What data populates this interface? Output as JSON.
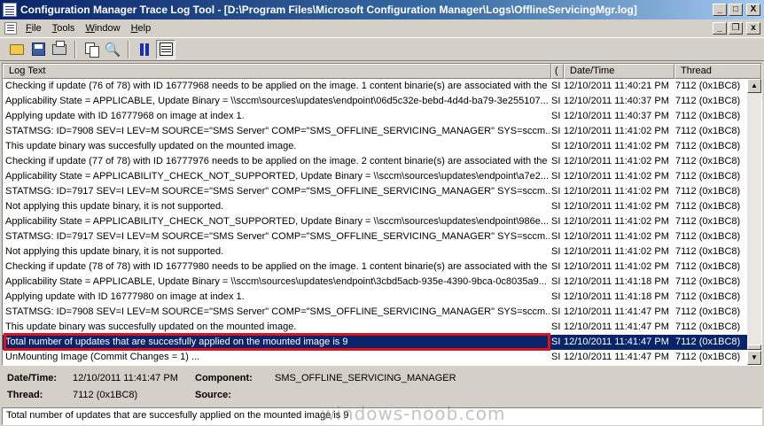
{
  "window": {
    "title": "Configuration Manager Trace Log Tool - [D:\\Program Files\\Microsoft Configuration Manager\\Logs\\OfflineServicingMgr.log]",
    "minimize_glyph": "_",
    "restore_glyph": "□",
    "close_glyph": "X"
  },
  "menu": {
    "items": [
      {
        "label": "File"
      },
      {
        "label": "Tools"
      },
      {
        "label": "Window"
      },
      {
        "label": "Help"
      }
    ],
    "mdi_minimize": "_",
    "mdi_restore": "❐",
    "mdi_close": "x"
  },
  "toolbar": {
    "icons": [
      "open-icon",
      "save-icon",
      "print-icon",
      "copy-icon",
      "find-icon",
      "pause-icon",
      "filter-list-icon"
    ]
  },
  "log": {
    "columns": [
      "Log Text",
      "(",
      "Date/Time",
      "Thread"
    ],
    "rows": [
      {
        "text": "Checking if update (76 of 78) with ID 16777968 needs to be applied on the image. 1 content binarie(s) are associated with the ...",
        "comp": "SI",
        "datetime": "12/10/2011 11:40:21 PM",
        "thread": "7112 (0x1BC8)"
      },
      {
        "text": "Applicability State = APPLICABLE, Update Binary = \\\\sccm\\sources\\updates\\endpoint\\06d5c32e-bebd-4d4d-ba79-3e255107...",
        "comp": "SI",
        "datetime": "12/10/2011 11:40:37 PM",
        "thread": "7112 (0x1BC8)"
      },
      {
        "text": "Applying update with ID 16777968 on image at index 1.",
        "comp": "SI",
        "datetime": "12/10/2011 11:40:37 PM",
        "thread": "7112 (0x1BC8)"
      },
      {
        "text": "STATMSG: ID=7908 SEV=I LEV=M SOURCE=\"SMS Server\" COMP=\"SMS_OFFLINE_SERVICING_MANAGER\" SYS=sccm....",
        "comp": "SI",
        "datetime": "12/10/2011 11:41:02 PM",
        "thread": "7112 (0x1BC8)"
      },
      {
        "text": "This update binary was succesfully updated on the mounted image.",
        "comp": "SI",
        "datetime": "12/10/2011 11:41:02 PM",
        "thread": "7112 (0x1BC8)"
      },
      {
        "text": "Checking if update (77 of 78) with ID 16777976 needs to be applied on the image. 2 content binarie(s) are associated with the ...",
        "comp": "SI",
        "datetime": "12/10/2011 11:41:02 PM",
        "thread": "7112 (0x1BC8)"
      },
      {
        "text": "Applicability State = APPLICABILITY_CHECK_NOT_SUPPORTED, Update Binary = \\\\sccm\\sources\\updates\\endpoint\\a7e2...",
        "comp": "SI",
        "datetime": "12/10/2011 11:41:02 PM",
        "thread": "7112 (0x1BC8)"
      },
      {
        "text": "STATMSG: ID=7917 SEV=I LEV=M SOURCE=\"SMS Server\" COMP=\"SMS_OFFLINE_SERVICING_MANAGER\" SYS=sccm....",
        "comp": "SI",
        "datetime": "12/10/2011 11:41:02 PM",
        "thread": "7112 (0x1BC8)"
      },
      {
        "text": "Not applying this update binary, it is not supported.",
        "comp": "SI",
        "datetime": "12/10/2011 11:41:02 PM",
        "thread": "7112 (0x1BC8)"
      },
      {
        "text": "Applicability State = APPLICABILITY_CHECK_NOT_SUPPORTED, Update Binary = \\\\sccm\\sources\\updates\\endpoint\\986e...",
        "comp": "SI",
        "datetime": "12/10/2011 11:41:02 PM",
        "thread": "7112 (0x1BC8)"
      },
      {
        "text": "STATMSG: ID=7917 SEV=I LEV=M SOURCE=\"SMS Server\" COMP=\"SMS_OFFLINE_SERVICING_MANAGER\" SYS=sccm....",
        "comp": "SI",
        "datetime": "12/10/2011 11:41:02 PM",
        "thread": "7112 (0x1BC8)"
      },
      {
        "text": "Not applying this update binary, it is not supported.",
        "comp": "SI",
        "datetime": "12/10/2011 11:41:02 PM",
        "thread": "7112 (0x1BC8)"
      },
      {
        "text": "Checking if update (78 of 78) with ID 16777980 needs to be applied on the image. 1 content binarie(s) are associated with the ...",
        "comp": "SI",
        "datetime": "12/10/2011 11:41:02 PM",
        "thread": "7112 (0x1BC8)"
      },
      {
        "text": "Applicability State = APPLICABLE, Update Binary = \\\\sccm\\sources\\updates\\endpoint\\3cbd5acb-935e-4390-9bca-0c8035a9...",
        "comp": "SI",
        "datetime": "12/10/2011 11:41:18 PM",
        "thread": "7112 (0x1BC8)"
      },
      {
        "text": "Applying update with ID 16777980 on image at index 1.",
        "comp": "SI",
        "datetime": "12/10/2011 11:41:18 PM",
        "thread": "7112 (0x1BC8)"
      },
      {
        "text": "STATMSG: ID=7908 SEV=I LEV=M SOURCE=\"SMS Server\" COMP=\"SMS_OFFLINE_SERVICING_MANAGER\" SYS=sccm....",
        "comp": "SI",
        "datetime": "12/10/2011 11:41:47 PM",
        "thread": "7112 (0x1BC8)"
      },
      {
        "text": "This update binary was succesfully updated on the mounted image.",
        "comp": "SI",
        "datetime": "12/10/2011 11:41:47 PM",
        "thread": "7112 (0x1BC8)"
      },
      {
        "text": "Total number of updates that are succesfully applied on the mounted image is 9",
        "comp": "SI",
        "datetime": "12/10/2011 11:41:47 PM",
        "thread": "7112 (0x1BC8)",
        "selected": true
      },
      {
        "text": "UnMounting Image (Commit Changes = 1) ...",
        "comp": "SI",
        "datetime": "12/10/2011 11:41:47 PM",
        "thread": "7112 (0x1BC8)"
      }
    ]
  },
  "details": {
    "datetime_label": "Date/Time:",
    "datetime_value": "12/10/2011 11:41:47 PM",
    "component_label": "Component:",
    "component_value": "SMS_OFFLINE_SERVICING_MANAGER",
    "thread_label": "Thread:",
    "thread_value": "7112 (0x1BC8)",
    "source_label": "Source:",
    "source_value": "",
    "message": "Total number of updates that are succesfully applied on the mounted image is 9"
  },
  "watermark": "windows-noob.com"
}
